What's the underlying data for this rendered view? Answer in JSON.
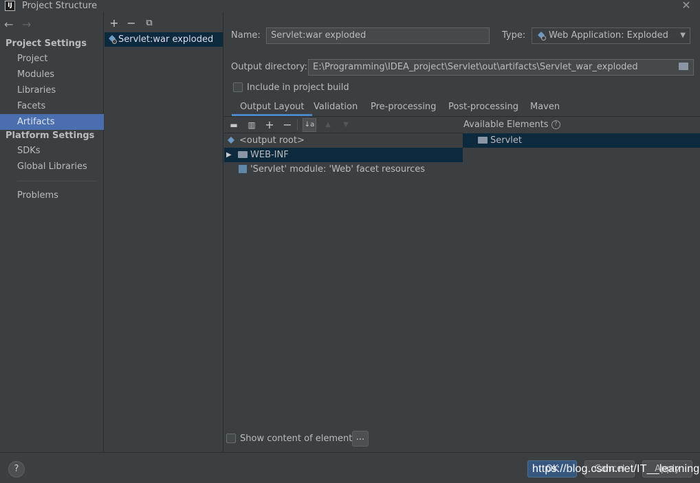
{
  "window": {
    "title": "Project Structure",
    "app_icon_text": "IJ"
  },
  "sidebar": {
    "project_settings_header": "Project Settings",
    "project_items": [
      "Project",
      "Modules",
      "Libraries",
      "Facets",
      "Artifacts"
    ],
    "selected_item": "Artifacts",
    "platform_settings_header": "Platform Settings",
    "platform_items": [
      "SDKs",
      "Global Libraries"
    ],
    "problems": "Problems"
  },
  "artifact_list": {
    "items": [
      "Servlet:war exploded"
    ]
  },
  "details": {
    "name_label": "Name:",
    "name_value": "Servlet:war exploded",
    "type_label": "Type:",
    "type_value": "Web Application: Exploded",
    "output_dir_label": "Output directory:",
    "output_dir_value": "E:\\Programming\\IDEA_project\\Servlet\\out\\artifacts\\Servlet_war_exploded",
    "include_in_build_label": "Include in project build",
    "include_in_build_checked": false,
    "tabs": [
      "Output Layout",
      "Validation",
      "Pre-processing",
      "Post-processing",
      "Maven"
    ],
    "active_tab": "Output Layout"
  },
  "output_layout": {
    "root": "<output root>",
    "items": [
      {
        "label": "WEB-INF",
        "kind": "folder",
        "selected": true
      },
      {
        "label": "'Servlet' module: 'Web' facet resources",
        "kind": "module-resources",
        "selected": false
      }
    ]
  },
  "available_elements": {
    "header": "Available Elements",
    "items": [
      "Servlet"
    ]
  },
  "footer": {
    "show_content_label": "Show content of elements",
    "show_content_checked": false,
    "ellipsis_label": "...",
    "ok_label": "OK",
    "cancel_label": "Cancel",
    "apply_label": "Apply",
    "help_label": "?"
  },
  "watermark": "https://blog.csdn.net/IT__learning",
  "colors": {
    "selection": "#4b6eaf",
    "tree_selection": "#0d293e",
    "background": "#3c3f41",
    "tab_underline": "#4a88c7"
  }
}
